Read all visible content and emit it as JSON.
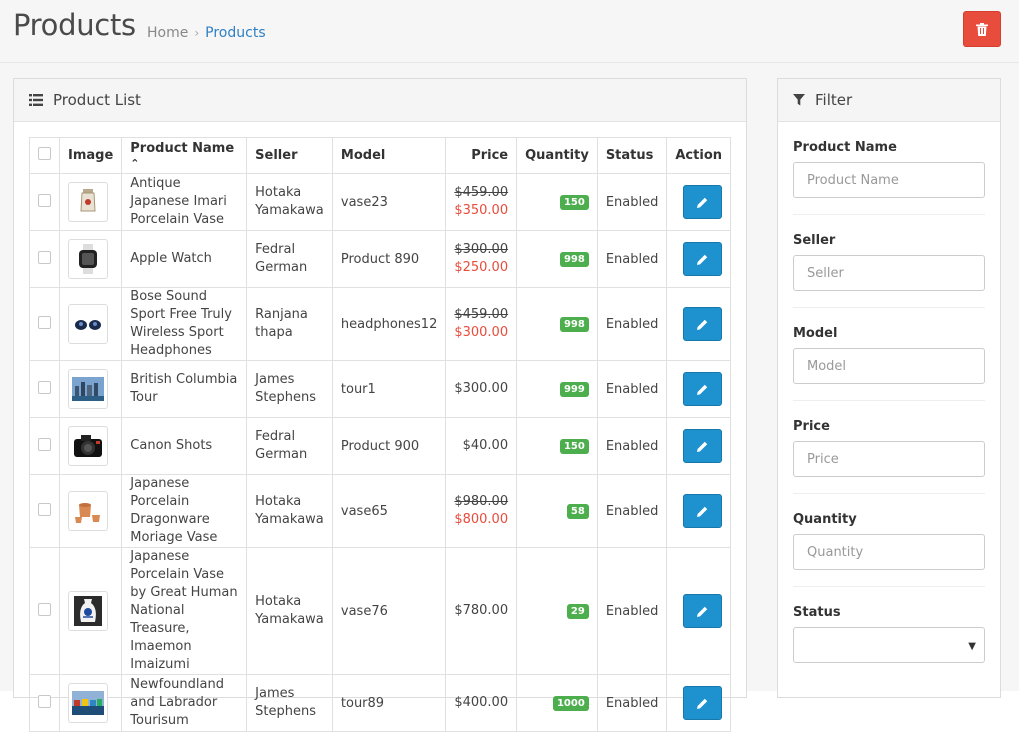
{
  "header": {
    "title": "Products",
    "breadcrumb": {
      "home": "Home",
      "separator": "›",
      "current": "Products"
    }
  },
  "list_panel": {
    "heading": "Product List",
    "columns": {
      "image": "Image",
      "name": "Product Name",
      "sort_indicator": "⌃",
      "seller": "Seller",
      "model": "Model",
      "price": "Price",
      "quantity": "Quantity",
      "status": "Status",
      "action": "Action"
    },
    "rows": [
      {
        "name": "Antique Japanese Imari Porcelain Vase",
        "seller": "Hotaka Yamakawa",
        "model": "vase23",
        "old_price": "$459.00",
        "price": "$350.00",
        "quantity": "150",
        "status": "Enabled",
        "icon": "vase-icon"
      },
      {
        "name": "Apple Watch",
        "seller": "Fedral German",
        "model": "Product 890",
        "old_price": "$300.00",
        "price": "$250.00",
        "quantity": "998",
        "status": "Enabled",
        "icon": "watch-icon"
      },
      {
        "name": "Bose Sound Sport Free Truly Wireless Sport Headphones",
        "seller": "Ranjana thapa",
        "model": "headphones12",
        "old_price": "$459.00",
        "price": "$300.00",
        "quantity": "998",
        "status": "Enabled",
        "icon": "earbuds-icon"
      },
      {
        "name": "British Columbia Tour",
        "seller": "James Stephens",
        "model": "tour1",
        "old_price": "",
        "price": "$300.00",
        "quantity": "999",
        "status": "Enabled",
        "icon": "city-photo-icon"
      },
      {
        "name": "Canon Shots",
        "seller": "Fedral German",
        "model": "Product 900",
        "old_price": "",
        "price": "$40.00",
        "quantity": "150",
        "status": "Enabled",
        "icon": "camera-icon"
      },
      {
        "name": "Japanese Porcelain Dragonware Moriage Vase",
        "seller": "Hotaka Yamakawa",
        "model": "vase65",
        "old_price": "$980.00",
        "price": "$800.00",
        "quantity": "58",
        "status": "Enabled",
        "icon": "teaset-icon"
      },
      {
        "name": "Japanese Porcelain Vase by Great Human National Treasure, Imaemon Imaizumi",
        "seller": "Hotaka Yamakawa",
        "model": "vase76",
        "old_price": "",
        "price": "$780.00",
        "quantity": "29",
        "status": "Enabled",
        "icon": "porcelain-vase-icon"
      },
      {
        "name": "Newfoundland and Labrador Tourisum",
        "seller": "James Stephens",
        "model": "tour89",
        "old_price": "",
        "price": "$400.00",
        "quantity": "1000",
        "status": "Enabled",
        "icon": "harbor-photo-icon"
      }
    ]
  },
  "filter_panel": {
    "heading": "Filter",
    "fields": [
      {
        "label": "Product Name",
        "placeholder": "Product Name"
      },
      {
        "label": "Seller",
        "placeholder": "Seller"
      },
      {
        "label": "Model",
        "placeholder": "Model"
      },
      {
        "label": "Price",
        "placeholder": "Price"
      },
      {
        "label": "Quantity",
        "placeholder": "Quantity"
      }
    ],
    "status": {
      "label": "Status",
      "value": ""
    }
  },
  "colors": {
    "accent": "#2f80c3",
    "danger": "#e74c3c",
    "edit_button": "#1e91cf",
    "badge": "#4cae4c"
  }
}
